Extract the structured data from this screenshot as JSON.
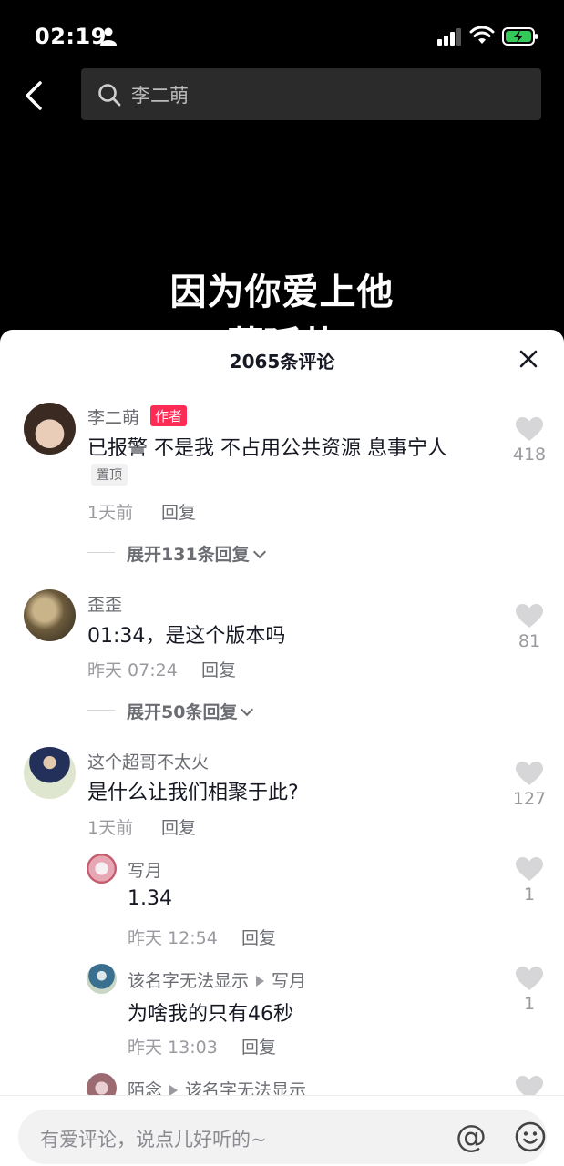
{
  "status_bar": {
    "time": "02:19"
  },
  "search": {
    "query": "李二萌"
  },
  "video": {
    "caption_line1": "因为你爱上他",
    "caption_line2": "蔓延井"
  },
  "comments_header": {
    "title": "2065条评论"
  },
  "comments": [
    {
      "user": "李二萌",
      "author_tag": "作者",
      "text": "已报警 不是我 不占用公共资源 息事宁人",
      "pin_tag": "置顶",
      "time": "1天前",
      "reply_label": "回复",
      "likes": "418",
      "expand_label": "展开131条回复"
    },
    {
      "user": "歪歪",
      "text": "01:34，是这个版本吗",
      "time": "昨天 07:24",
      "reply_label": "回复",
      "likes": "81",
      "expand_label": "展开50条回复"
    },
    {
      "user": "这个超哥不太火",
      "text": "是什么让我们相聚于此?",
      "time": "1天前",
      "reply_label": "回复",
      "likes": "127"
    }
  ],
  "replies": [
    {
      "user": "写月",
      "text": "1.34",
      "time": "昨天 12:54",
      "reply_label": "回复",
      "likes": "1"
    },
    {
      "user": "该名字无法显示",
      "reply_to": "写月",
      "text": "为啥我的只有46秒",
      "time": "昨天 13:03",
      "reply_label": "回复",
      "likes": "1"
    },
    {
      "user": "陌念",
      "reply_to": "该名字无法显示"
    }
  ],
  "input": {
    "placeholder": "有爱评论，说点儿好听的~",
    "at_symbol": "@"
  }
}
